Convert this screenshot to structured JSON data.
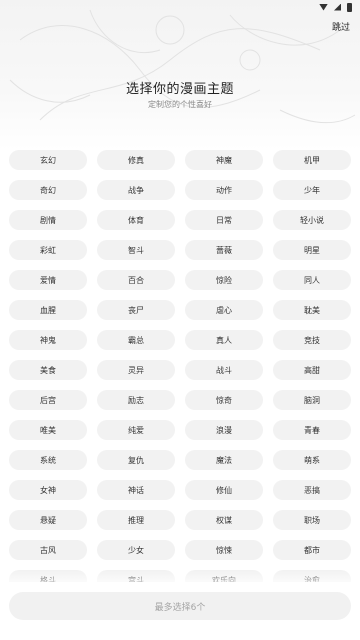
{
  "status_bar": {
    "icons": [
      "wifi-icon",
      "signal-icon",
      "battery-icon"
    ]
  },
  "header": {
    "skip_label": "跳过",
    "title": "选择你的漫画主题",
    "subtitle": "定制您的个性喜好"
  },
  "genres": [
    "玄幻",
    "修真",
    "神魔",
    "机甲",
    "奇幻",
    "战争",
    "动作",
    "少年",
    "剧情",
    "体育",
    "日常",
    "轻小说",
    "彩虹",
    "智斗",
    "蔷薇",
    "明星",
    "爱情",
    "百合",
    "惊险",
    "同人",
    "血腥",
    "丧尸",
    "虐心",
    "耽美",
    "神鬼",
    "霸总",
    "真人",
    "竞技",
    "美食",
    "灵异",
    "战斗",
    "高甜",
    "后宫",
    "励志",
    "惊奇",
    "脑洞",
    "唯美",
    "纯爱",
    "浪漫",
    "青春",
    "系统",
    "复仇",
    "魔法",
    "萌系",
    "女神",
    "神话",
    "修仙",
    "恶搞",
    "悬疑",
    "推理",
    "权谋",
    "职场",
    "古风",
    "少女",
    "惊悚",
    "都市",
    "格斗",
    "宫斗",
    "欢乐向",
    "治愈"
  ],
  "footer": {
    "confirm_label": "最多选择6个"
  },
  "colors": {
    "chip_bg": "#f2f2f2",
    "button_bg": "#f1f1f1",
    "button_text": "#a5a5a5"
  }
}
